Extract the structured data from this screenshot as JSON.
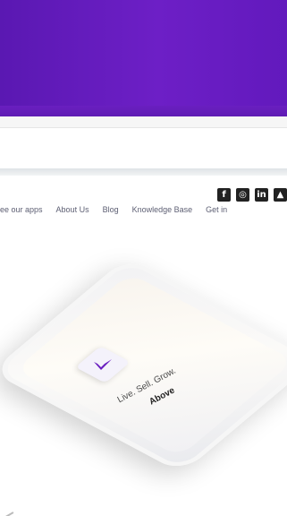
{
  "social": {
    "icons": [
      {
        "name": "facebook-icon",
        "glyph": "f"
      },
      {
        "name": "instagram-icon",
        "glyph": "◎"
      },
      {
        "name": "linkedin-icon",
        "glyph": "in"
      },
      {
        "name": "user-icon",
        "glyph": "▲"
      }
    ]
  },
  "nav": {
    "items": [
      "ee our apps",
      "About Us",
      "Blog",
      "Knowledge Base",
      "Get in"
    ]
  },
  "hero": {
    "tagline": "Live. Sell. Grow.",
    "tagline_emphasis": "Above"
  },
  "colors": {
    "banner": "#6a1ec4",
    "accent": "#6a1fc0"
  }
}
